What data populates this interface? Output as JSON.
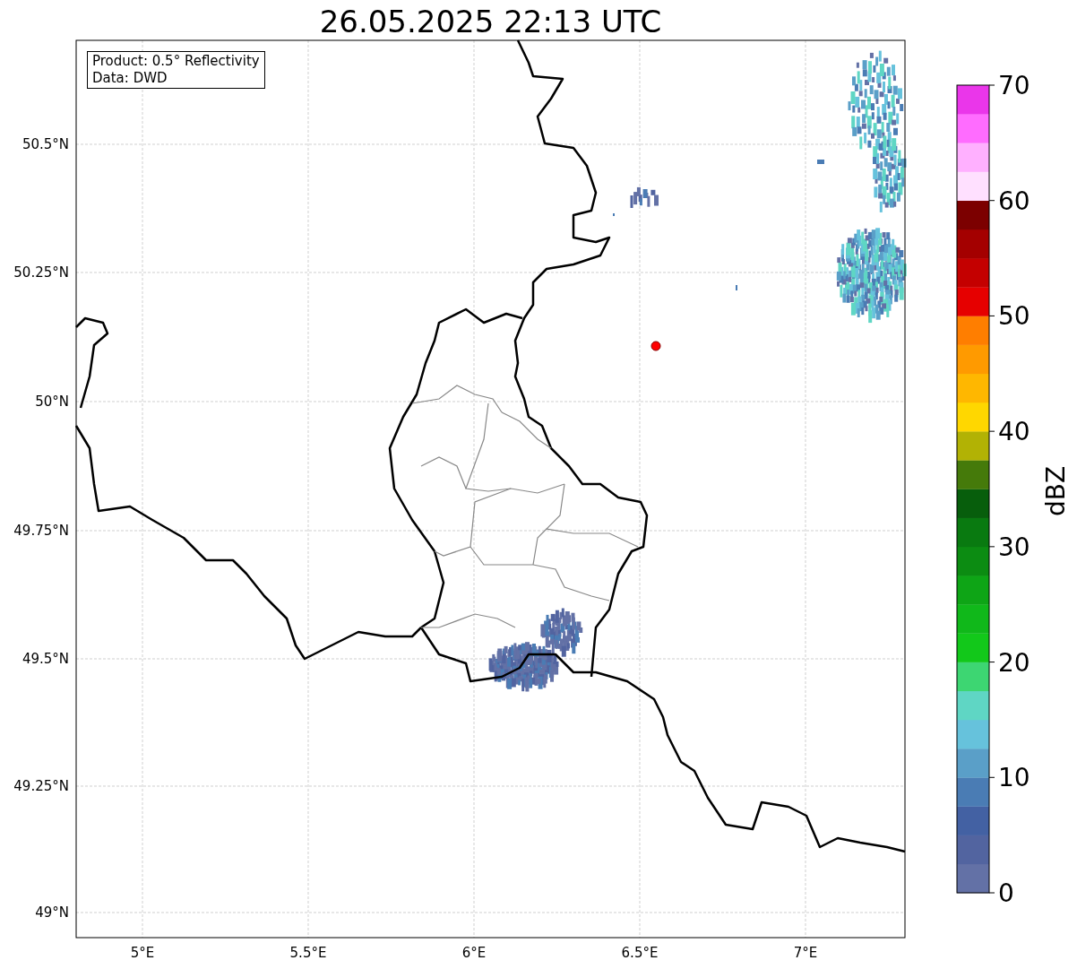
{
  "title": "26.05.2025 22:13 UTC",
  "info_box": [
    "Product: 0.5° Reflectivity",
    "Data: DWD"
  ],
  "lat_labels": [
    "50.5°N",
    "50.25°N",
    "50°N",
    "49.75°N",
    "49.5°N",
    "49.25°N",
    "49°N"
  ],
  "lon_labels": [
    "5°E",
    "5.5°E",
    "6°E",
    "6.5°E",
    "7°E"
  ],
  "colorbar": {
    "label": "dBZ",
    "ticks": [
      "70",
      "60",
      "50",
      "40",
      "30",
      "20",
      "10",
      "0"
    ],
    "segments": [
      {
        "color": "#6371a6"
      },
      {
        "color": "#5264a0"
      },
      {
        "color": "#4361a3"
      },
      {
        "color": "#4a7cb4"
      },
      {
        "color": "#5a9fc8"
      },
      {
        "color": "#66c2dc"
      },
      {
        "color": "#5fd6c4"
      },
      {
        "color": "#3dd672"
      },
      {
        "color": "#12c81a"
      },
      {
        "color": "#10b81a"
      },
      {
        "color": "#0ea516"
      },
      {
        "color": "#0c8c12"
      },
      {
        "color": "#097a10"
      },
      {
        "color": "#075e0c"
      },
      {
        "color": "#457a0a"
      },
      {
        "color": "#b2b204"
      },
      {
        "color": "#ffd700"
      },
      {
        "color": "#ffb700"
      },
      {
        "color": "#ff9a00"
      },
      {
        "color": "#ff7e00"
      },
      {
        "color": "#e60000"
      },
      {
        "color": "#c40000"
      },
      {
        "color": "#a40000"
      },
      {
        "color": "#7c0000"
      },
      {
        "color": "#ffe0ff"
      },
      {
        "color": "#ffb0ff"
      },
      {
        "color": "#ff6cff"
      },
      {
        "color": "#ea36ea"
      }
    ]
  }
}
